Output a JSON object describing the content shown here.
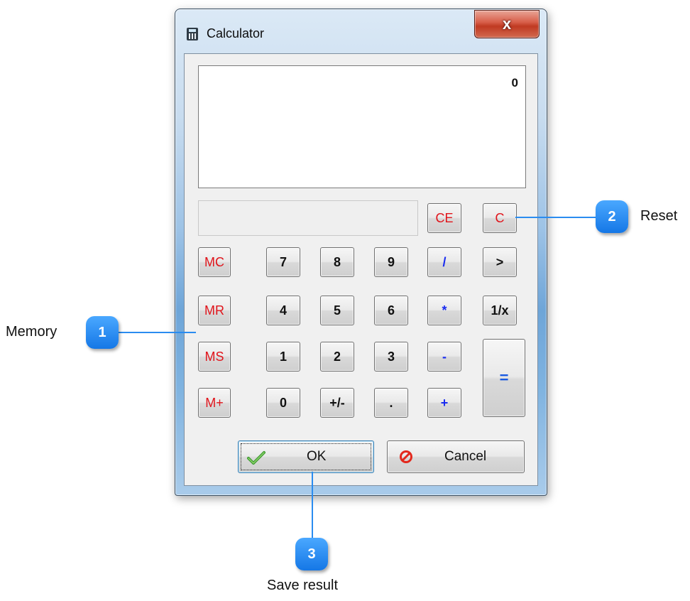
{
  "window": {
    "title": "Calculator",
    "close_label": "x"
  },
  "display": {
    "value": "0",
    "memory_indicator": ""
  },
  "buttons": {
    "ce": "CE",
    "c": "C",
    "mc": "MC",
    "mr": "MR",
    "ms": "MS",
    "mplus": "M+",
    "n7": "7",
    "n8": "8",
    "n9": "9",
    "divide": "/",
    "backspace": ">",
    "n4": "4",
    "n5": "5",
    "n6": "6",
    "multiply": "*",
    "reciprocal": "1/x",
    "n1": "1",
    "n2": "2",
    "n3": "3",
    "subtract": "-",
    "equals": "=",
    "n0": "0",
    "sign": "+/-",
    "decimal": ".",
    "add": "+"
  },
  "dialog": {
    "ok_label": "OK",
    "cancel_label": "Cancel"
  },
  "callouts": [
    {
      "number": "1",
      "label": "Memory"
    },
    {
      "number": "2",
      "label": "Reset"
    },
    {
      "number": "3",
      "label": "Save result"
    }
  ],
  "colors": {
    "red_text": "#e0141b",
    "blue_text": "#1a2cf0",
    "callout_blue": "#1577e6"
  },
  "icons": {
    "app": "calculator-icon",
    "ok": "checkmark-icon",
    "cancel": "prohibited-icon"
  }
}
